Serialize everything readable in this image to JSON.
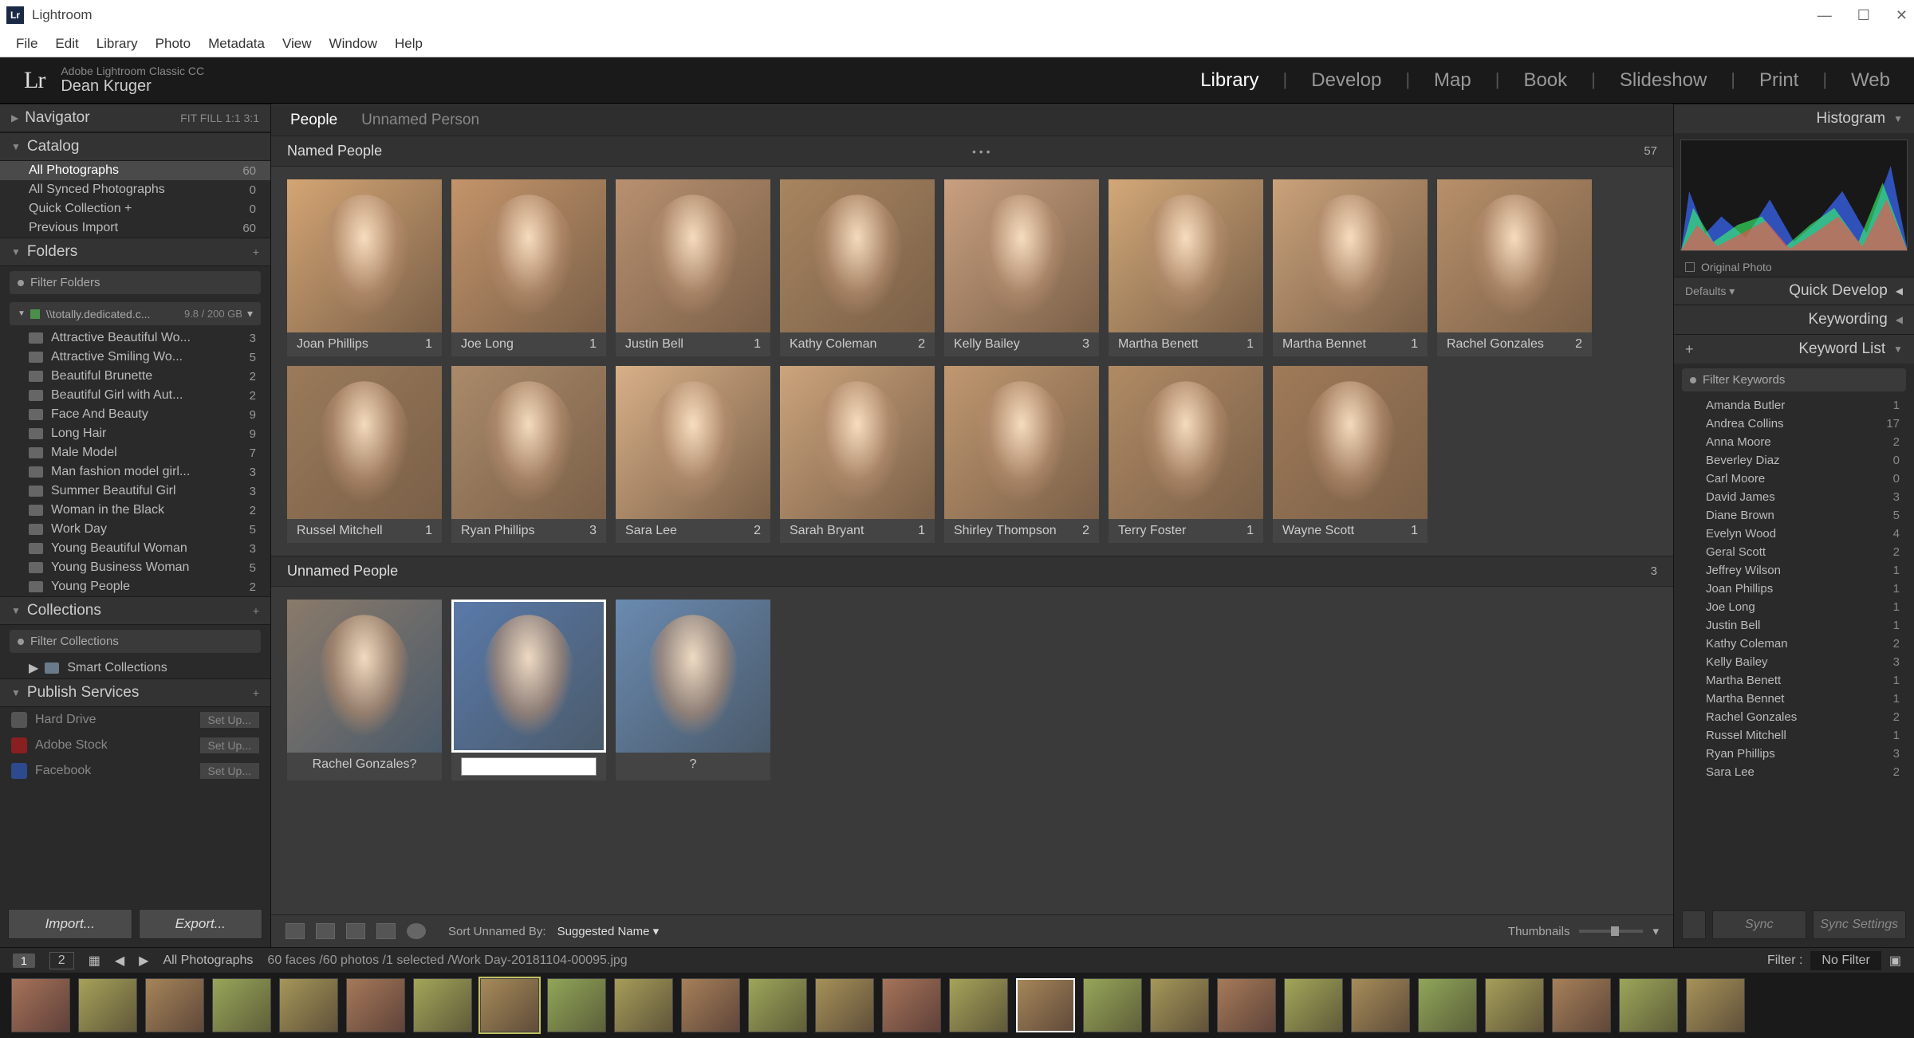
{
  "window": {
    "title": "Lightroom"
  },
  "menubar": [
    "File",
    "Edit",
    "Library",
    "Photo",
    "Metadata",
    "View",
    "Window",
    "Help"
  ],
  "identity": {
    "product": "Adobe Lightroom Classic CC",
    "user": "Dean Kruger",
    "logo": "Lr"
  },
  "modules": [
    "Library",
    "Develop",
    "Map",
    "Book",
    "Slideshow",
    "Print",
    "Web"
  ],
  "active_module": "Library",
  "navigator": {
    "title": "Navigator",
    "modes": "FIT   FILL   1:1    3:1"
  },
  "catalog": {
    "title": "Catalog",
    "items": [
      {
        "label": "All Photographs",
        "count": 60,
        "selected": true
      },
      {
        "label": "All Synced Photographs",
        "count": 0
      },
      {
        "label": "Quick Collection  +",
        "count": 0
      },
      {
        "label": "Previous Import",
        "count": 60
      }
    ]
  },
  "folders_panel": {
    "title": "Folders",
    "filter_placeholder": "Filter Folders",
    "volume": {
      "path": "\\\\totally.dedicated.c...",
      "usage": "9.8 / 200 GB"
    },
    "folders": [
      {
        "label": "Attractive Beautiful Wo...",
        "count": 3
      },
      {
        "label": "Attractive Smiling Wo...",
        "count": 5
      },
      {
        "label": "Beautiful Brunette",
        "count": 2
      },
      {
        "label": "Beautiful Girl with Aut...",
        "count": 2
      },
      {
        "label": "Face And Beauty",
        "count": 9
      },
      {
        "label": "Long Hair",
        "count": 9
      },
      {
        "label": "Male Model",
        "count": 7
      },
      {
        "label": "Man fashion model girl...",
        "count": 3
      },
      {
        "label": "Summer Beautiful Girl",
        "count": 3
      },
      {
        "label": "Woman in the Black",
        "count": 2
      },
      {
        "label": "Work Day",
        "count": 5
      },
      {
        "label": "Young Beautiful Woman",
        "count": 3
      },
      {
        "label": "Young Business Woman",
        "count": 5
      },
      {
        "label": "Young People",
        "count": 2
      }
    ]
  },
  "collections": {
    "title": "Collections",
    "filter_placeholder": "Filter Collections",
    "smart_label": "Smart Collections"
  },
  "publish": {
    "title": "Publish Services",
    "services": [
      {
        "label": "Hard Drive",
        "action": "Set Up...",
        "color": "#555"
      },
      {
        "label": "Adobe Stock",
        "action": "Set Up...",
        "color": "#8a1f1f"
      },
      {
        "label": "Facebook",
        "action": "Set Up...",
        "color": "#2d4a8f"
      }
    ]
  },
  "buttons": {
    "import": "Import...",
    "export": "Export...",
    "sync": "Sync",
    "sync_settings": "Sync Settings"
  },
  "people_tabs": {
    "people": "People",
    "unnamed": "Unnamed Person"
  },
  "named_section": {
    "title": "Named People",
    "count": 57
  },
  "named_people": [
    {
      "name": "Joan Phillips",
      "count": 1
    },
    {
      "name": "Joe Long",
      "count": 1
    },
    {
      "name": "Justin Bell",
      "count": 1
    },
    {
      "name": "Kathy Coleman",
      "count": 2
    },
    {
      "name": "Kelly Bailey",
      "count": 3
    },
    {
      "name": "Martha Benett",
      "count": 1
    },
    {
      "name": "Martha Bennet",
      "count": 1
    },
    {
      "name": "Rachel Gonzales",
      "count": 2
    },
    {
      "name": "Russel Mitchell",
      "count": 1
    },
    {
      "name": "Ryan Phillips",
      "count": 3
    },
    {
      "name": "Sara Lee",
      "count": 2
    },
    {
      "name": "Sarah Bryant",
      "count": 1
    },
    {
      "name": "Shirley Thompson",
      "count": 2
    },
    {
      "name": "Terry Foster",
      "count": 1
    },
    {
      "name": "Wayne Scott",
      "count": 1
    }
  ],
  "unnamed_section": {
    "title": "Unnamed People",
    "count": 3
  },
  "unnamed_people": [
    {
      "suggestion": "Rachel Gonzales?",
      "selected": false,
      "editing": false
    },
    {
      "suggestion": "",
      "selected": true,
      "editing": true
    },
    {
      "suggestion": "?",
      "selected": false,
      "editing": false
    }
  ],
  "toolbar": {
    "sort_label": "Sort Unnamed By:",
    "sort_value": "Suggested Name",
    "thumbs_label": "Thumbnails"
  },
  "right": {
    "histogram_title": "Histogram",
    "original_photo": "Original Photo",
    "defaults": "Defaults",
    "quick_develop": "Quick Develop",
    "keywording": "Keywording",
    "keyword_list": "Keyword List",
    "filter_placeholder": "Filter Keywords",
    "keywords": [
      {
        "label": "Amanda Butler",
        "count": 1
      },
      {
        "label": "Andrea Collins",
        "count": 17
      },
      {
        "label": "Anna Moore",
        "count": 2
      },
      {
        "label": "Beverley Diaz",
        "count": 0
      },
      {
        "label": "Carl Moore",
        "count": 0
      },
      {
        "label": "David James",
        "count": 3
      },
      {
        "label": "Diane Brown",
        "count": 5
      },
      {
        "label": "Evelyn Wood",
        "count": 4
      },
      {
        "label": "Geral Scott",
        "count": 2
      },
      {
        "label": "Jeffrey Wilson",
        "count": 1
      },
      {
        "label": "Joan Phillips",
        "count": 1
      },
      {
        "label": "Joe Long",
        "count": 1
      },
      {
        "label": "Justin Bell",
        "count": 1
      },
      {
        "label": "Kathy Coleman",
        "count": 2
      },
      {
        "label": "Kelly Bailey",
        "count": 3
      },
      {
        "label": "Martha Benett",
        "count": 1
      },
      {
        "label": "Martha Bennet",
        "count": 1
      },
      {
        "label": "Rachel Gonzales",
        "count": 2
      },
      {
        "label": "Russel Mitchell",
        "count": 1
      },
      {
        "label": "Ryan Phillips",
        "count": 3
      },
      {
        "label": "Sara Lee",
        "count": 2
      }
    ]
  },
  "statusbar": {
    "pages": [
      "1",
      "2"
    ],
    "breadcrumb": "All Photographs",
    "info": "60 faces /60 photos /1 selected /Work Day-20181104-00095.jpg",
    "filter_label": "Filter :",
    "filter_value": "No Filter"
  },
  "filmstrip_count": 26,
  "filmstrip_selected": 15,
  "filmstrip_highlight": 7
}
